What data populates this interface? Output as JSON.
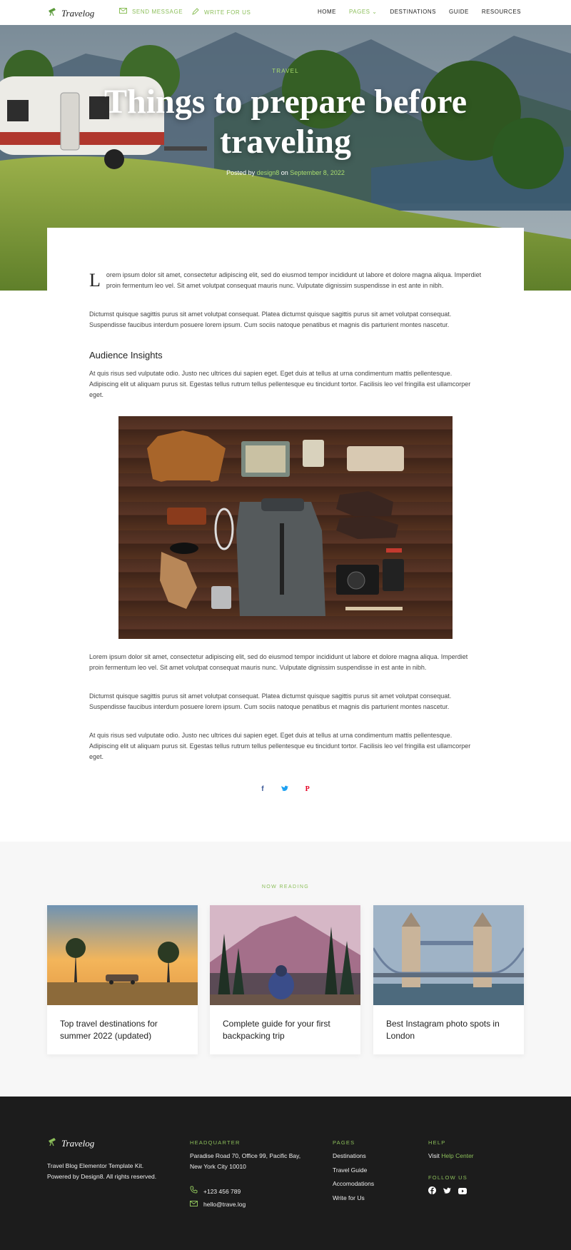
{
  "header": {
    "logo": "Travelog",
    "send_message": "SEND MESSAGE",
    "write_for_us": "WRITE FOR US",
    "nav": [
      {
        "label": "HOME"
      },
      {
        "label": "PAGES"
      },
      {
        "label": "DESTINATIONS"
      },
      {
        "label": "GUIDE"
      },
      {
        "label": "RESOURCES"
      }
    ]
  },
  "hero": {
    "category": "TRAVEL",
    "title": "Things to prepare before traveling",
    "posted_by": "Posted by",
    "author": "design8",
    "on": "on",
    "date": "September 8, 2022"
  },
  "article": {
    "dropcap": "L",
    "p1": "orem ipsum dolor sit amet, consectetur adipiscing elit, sed do eiusmod tempor incididunt ut labore et dolore magna aliqua. Imperdiet proin fermentum leo vel. Sit amet volutpat consequat mauris nunc. Vulputate dignissim suspendisse in est ante in nibh.",
    "p2": "Dictumst quisque sagittis purus sit amet volutpat consequat. Platea dictumst quisque sagittis purus sit amet volutpat consequat. Suspendisse faucibus interdum posuere lorem ipsum. Cum sociis natoque penatibus et magnis dis parturient montes nascetur.",
    "heading": "Audience Insights",
    "p3": "At quis risus sed vulputate odio. Justo nec ultrices dui sapien eget. Eget duis at tellus at urna condimentum mattis pellentesque. Adipiscing elit ut aliquam purus sit. Egestas tellus rutrum tellus pellentesque eu tincidunt tortor. Facilisis leo vel fringilla est ullamcorper eget.",
    "p4": "Lorem ipsum dolor sit amet, consectetur adipiscing elit, sed do eiusmod tempor incididunt ut labore et dolore magna aliqua. Imperdiet proin fermentum leo vel. Sit amet volutpat consequat mauris nunc. Vulputate dignissim suspendisse in est ante in nibh.",
    "p5": "Dictumst quisque sagittis purus sit amet volutpat consequat. Platea dictumst quisque sagittis purus sit amet volutpat consequat. Suspendisse faucibus interdum posuere lorem ipsum. Cum sociis natoque penatibus et magnis dis parturient montes nascetur.",
    "p6": "At quis risus sed vulputate odio. Justo nec ultrices dui sapien eget. Eget duis at tellus at urna condimentum mattis pellentesque. Adipiscing elit ut aliquam purus sit. Egestas tellus rutrum tellus pellentesque eu tincidunt tortor. Facilisis leo vel fringilla est ullamcorper eget."
  },
  "share": {
    "facebook": "f",
    "twitter": "🐦",
    "pinterest": "P",
    "colors": {
      "facebook": "#3b5998",
      "twitter": "#1da1f2",
      "pinterest": "#e60023"
    }
  },
  "now_reading": {
    "title": "NOW READING",
    "cards": [
      {
        "title": "Top travel destinations for summer 2022 (updated)"
      },
      {
        "title": "Complete guide for your first backpacking trip"
      },
      {
        "title": "Best Instagram photo spots in London"
      }
    ]
  },
  "footer": {
    "logo": "Travelog",
    "about": "Travel Blog Elementor Template Kit. Powered by Design8. All rights reserved.",
    "hq_title": "HEADQUARTER",
    "address": "Paradise Road 70, Office 99, Pacific Bay,  New York City 10010",
    "phone": "+123 456 789",
    "email": "hello@trave.log",
    "pages_title": "PAGES",
    "pages": [
      "Destinations",
      "Travel Guide",
      "Accomodations",
      "Write for Us"
    ],
    "help_title": "HELP",
    "help_visit": "Visit",
    "help_center": "Help Center",
    "follow_title": "FOLLOW US"
  },
  "colors": {
    "accent": "#8cbf5a",
    "footer_bg": "#1c1c1c",
    "section_bg": "#f7f7f7"
  }
}
